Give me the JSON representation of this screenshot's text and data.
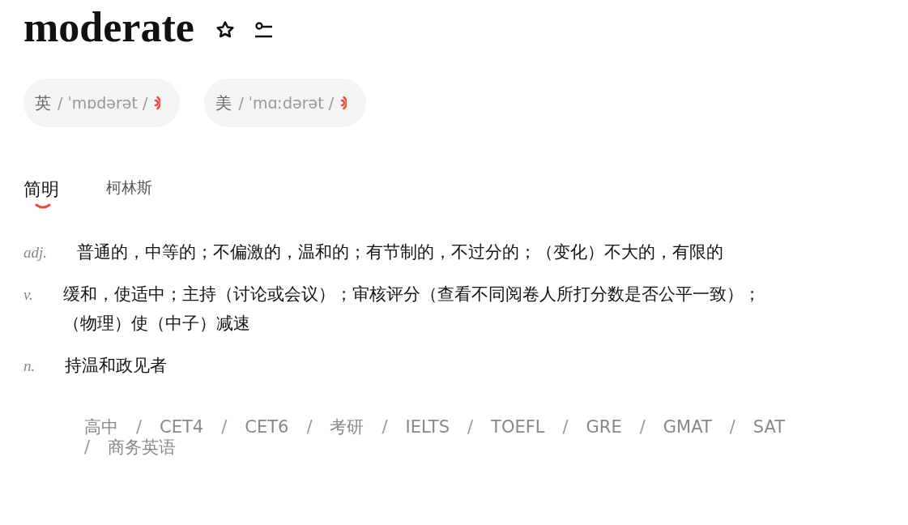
{
  "word": "moderate",
  "pronunciations": [
    {
      "region": "英",
      "phonetic": "/ ˈmɒdərət /"
    },
    {
      "region": "美",
      "phonetic": "/ ˈmɑːdərət /"
    }
  ],
  "tabs": [
    {
      "label": "简明",
      "selected": true
    },
    {
      "label": "柯林斯",
      "selected": false
    }
  ],
  "definitions": [
    {
      "pos": "adj.",
      "text": "普通的，中等的；不偏激的，温和的；有节制的，不过分的；（变化）不大的，有限的"
    },
    {
      "pos": "v.",
      "text": "缓和，使适中；主持（讨论或会议）；审核评分（查看不同阅卷人所打分数是否公平一致）；（物理）使（中子）减速"
    },
    {
      "pos": "n.",
      "text": "持温和政见者"
    }
  ],
  "exam_tags": {
    "separator": "/",
    "items": [
      "高中",
      "CET4",
      "CET6",
      "考研",
      "IELTS",
      "TOEFL",
      "GRE",
      "GMAT",
      "SAT",
      "商务英语"
    ]
  }
}
